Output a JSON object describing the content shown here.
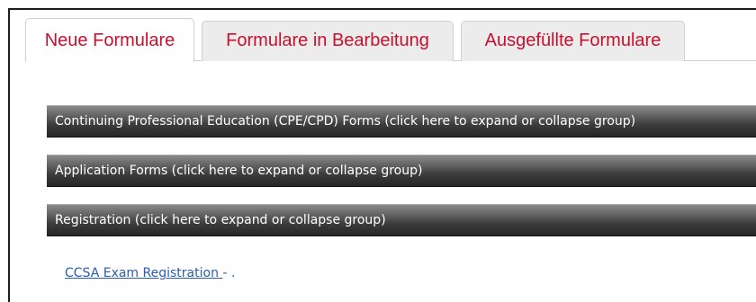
{
  "tabs": [
    {
      "label": "Neue Formulare",
      "active": true
    },
    {
      "label": "Formulare in Bearbeitung",
      "active": false
    },
    {
      "label": "Ausgefüllte Formulare",
      "active": false
    }
  ],
  "groups": [
    {
      "label": "Continuing Professional Education (CPE/CPD) Forms (click here to expand or collapse group)"
    },
    {
      "label": "Application Forms (click here to expand or collapse group)"
    },
    {
      "label": "Registration (click here to expand or collapse group)"
    }
  ],
  "registration_items": [
    {
      "link_label": "CCSA Exam Registration ",
      "suffix": "- ."
    }
  ],
  "colors": {
    "tab_text": "#c8102e",
    "link": "#2a5db0",
    "group_bar_dark": "#262626"
  }
}
